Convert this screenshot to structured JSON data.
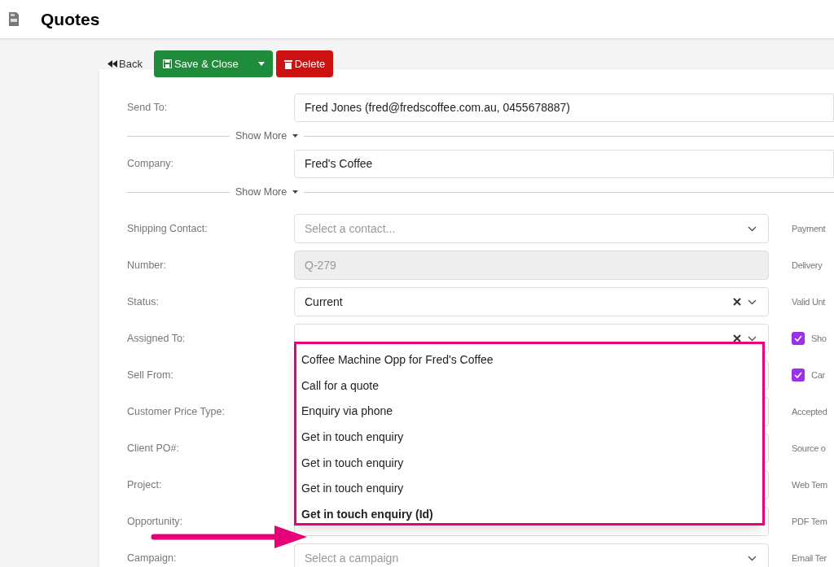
{
  "page": {
    "title": "Quotes"
  },
  "toolbar": {
    "back": "Back",
    "save": "Save & Close",
    "delete": "Delete"
  },
  "top_fields": [
    {
      "label": "Send To:",
      "value": "Fred Jones (fred@fredscoffee.com.au, 0455678887)",
      "toggle": "Show More"
    },
    {
      "label": "Company:",
      "value": "Fred's Coffee",
      "toggle": "Show More"
    }
  ],
  "fields": [
    {
      "label": "Shipping Contact:",
      "kind": "select",
      "placeholder": "Select a contact...",
      "clearable": false
    },
    {
      "label": "Number:",
      "kind": "readonly",
      "value": "Q-279"
    },
    {
      "label": "Status:",
      "kind": "select",
      "value": "Current",
      "clearable": true
    },
    {
      "label": "Assigned To:",
      "kind": "select",
      "clearable": true
    },
    {
      "label": "Sell From:",
      "kind": "select"
    },
    {
      "label": "Customer Price Type:",
      "kind": "select"
    },
    {
      "label": "Client PO#:",
      "kind": "select"
    },
    {
      "label": "Project:",
      "kind": "select"
    },
    {
      "label": "Opportunity:",
      "kind": "select"
    },
    {
      "label": "Campaign:",
      "kind": "select",
      "placeholder": "Select a campaign",
      "clearable": false
    }
  ],
  "side_fields": [
    {
      "kind": "label",
      "label": "Payment"
    },
    {
      "kind": "label",
      "label": "Delivery"
    },
    {
      "kind": "label",
      "label": "Valid Unt"
    },
    {
      "kind": "checkbox",
      "label": "Sho",
      "checked": true
    },
    {
      "kind": "checkbox",
      "label": "Car",
      "checked": true
    },
    {
      "kind": "label",
      "label": "Accepted"
    },
    {
      "kind": "label",
      "label": "Source o"
    },
    {
      "kind": "label",
      "label": "Web Tem"
    },
    {
      "kind": "label",
      "label": "PDF Tem"
    },
    {
      "kind": "label",
      "label": "Email Ter"
    }
  ],
  "dropdown": {
    "options": [
      {
        "label": "Coffee Machine Opp for Fred's Coffee",
        "bold": false
      },
      {
        "label": "Call for a quote",
        "bold": false
      },
      {
        "label": "Enquiry via phone",
        "bold": false
      },
      {
        "label": "Get in touch enquiry",
        "bold": false
      },
      {
        "label": "Get in touch enquiry",
        "bold": false
      },
      {
        "label": "Get in touch enquiry",
        "bold": false
      },
      {
        "label": "Get in touch enquiry (Id)",
        "bold": true
      }
    ]
  }
}
